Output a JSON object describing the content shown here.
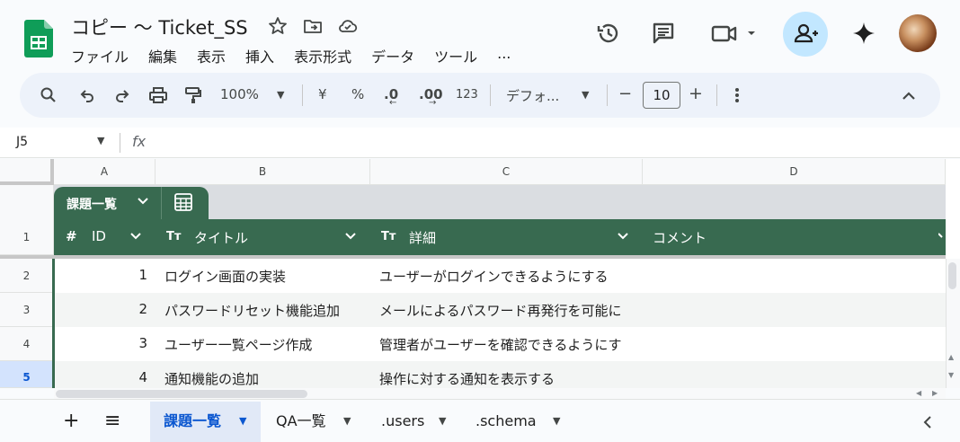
{
  "header": {
    "title": "コピー 〜 Ticket_SS",
    "menus": [
      "ファイル",
      "編集",
      "表示",
      "挿入",
      "表示形式",
      "データ",
      "ツール",
      "..."
    ],
    "icons": [
      "star-icon",
      "move-to-folder-icon",
      "cloud-saved-icon",
      "history-icon",
      "comment-icon",
      "meet-icon",
      "share-icon",
      "gemini-icon"
    ]
  },
  "toolbar": {
    "zoom": "100%",
    "currency": "¥",
    "percent": "%",
    "dec_decrease": ".0",
    "dec_increase": ".00",
    "number_format": "123",
    "font": "デフォ...",
    "font_size": "10",
    "minus": "−",
    "plus": "+"
  },
  "formula_bar": {
    "cell_ref": "J5",
    "fx": "fx",
    "value": ""
  },
  "columns": [
    "A",
    "B",
    "C",
    "D"
  ],
  "rows": [
    "1",
    "2",
    "3",
    "4",
    "5"
  ],
  "table": {
    "name": "課題一覧",
    "headers": [
      {
        "type_icon": "#",
        "label": "ID"
      },
      {
        "type_icon": "Tт",
        "label": "タイトル"
      },
      {
        "type_icon": "Tт",
        "label": "詳細"
      },
      {
        "type_icon": "",
        "label": "コメント"
      }
    ],
    "data": [
      {
        "id": "1",
        "title": "ログイン画面の実装",
        "detail": "ユーザーがログインできるようにする",
        "comment": ""
      },
      {
        "id": "2",
        "title": "パスワードリセット機能追加",
        "detail": "メールによるパスワード再発行を可能に",
        "comment": ""
      },
      {
        "id": "3",
        "title": "ユーザー一覧ページ作成",
        "detail": "管理者がユーザーを確認できるようにす",
        "comment": ""
      },
      {
        "id": "4",
        "title": "通知機能の追加",
        "detail": "操作に対する通知を表示する",
        "comment": ""
      }
    ]
  },
  "sheets": {
    "add": "+",
    "list": "≡",
    "tabs": [
      "課題一覧",
      "QA一覧",
      ".users",
      ".schema"
    ],
    "active": "課題一覧"
  },
  "colors": {
    "table_header": "#386a50",
    "active_tab": "#0b57d0",
    "share": "#c2e7ff"
  }
}
